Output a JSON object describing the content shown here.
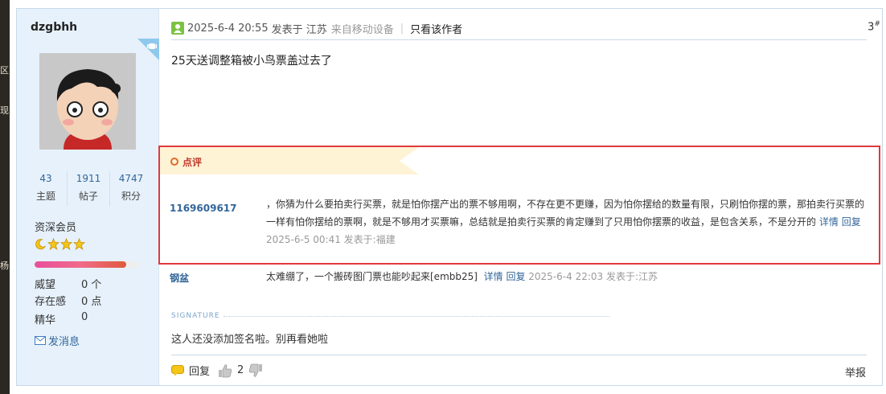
{
  "side_strip": {
    "glyphs": [
      "区",
      "现",
      "杨"
    ]
  },
  "author": {
    "username": "dzgbhh",
    "stats": [
      {
        "value": "43",
        "label": "主题"
      },
      {
        "value": "1911",
        "label": "帖子"
      },
      {
        "value": "4747",
        "label": "积分"
      }
    ],
    "rank": "资深会员",
    "level_progress": 0.88,
    "attributes": [
      {
        "key": "威望",
        "value": "0 个"
      },
      {
        "key": "存在感",
        "value": "0 点"
      },
      {
        "key": "精华",
        "value": "0"
      }
    ],
    "send_message": "发消息"
  },
  "post": {
    "time": "2025-6-4 20:55",
    "posted_in": "发表于 江苏",
    "device": "来自移动设备",
    "separator": "|",
    "only_author": "只看该作者",
    "floor": "3",
    "floor_mark": "#",
    "content": "25天送调整箱被小鸟票盖过去了"
  },
  "review": {
    "tag": "点评",
    "comments": [
      {
        "user": "1169609617",
        "line1": "，你猜为什么要拍卖行买票，就是怕你摆产出的票不够用啊，不存在更不更赚，因为怕你摆给的数量有限，只刷怕你摆的票，那拍卖行买票的",
        "line2": "一样有怕你摆给的票啊，就是不够用才买票嘛，总结就是拍卖行买票的肯定赚到了只用怕你摆票的收益，是包含关系，不是分开的",
        "detail": "详情",
        "reply": "回复",
        "meta": "2025-6-5 00:41 发表于:福建"
      },
      {
        "user": "钢盆",
        "text": "太难绷了，一个搬砖图门票也能吵起来[embb25]",
        "detail": "详情",
        "reply": "回复",
        "meta": "2025-6-4 22:03 发表于:江苏"
      }
    ]
  },
  "signature": {
    "label": "SIGNATURE",
    "text": "这人还没添加签名啦。别再看她啦"
  },
  "actions": {
    "reply": "回复",
    "like_count": "2",
    "report": "举报"
  },
  "colors": {
    "link": "#336699",
    "highlight_border": "#e0393e",
    "sidebar_bg": "#e6f1fb"
  }
}
